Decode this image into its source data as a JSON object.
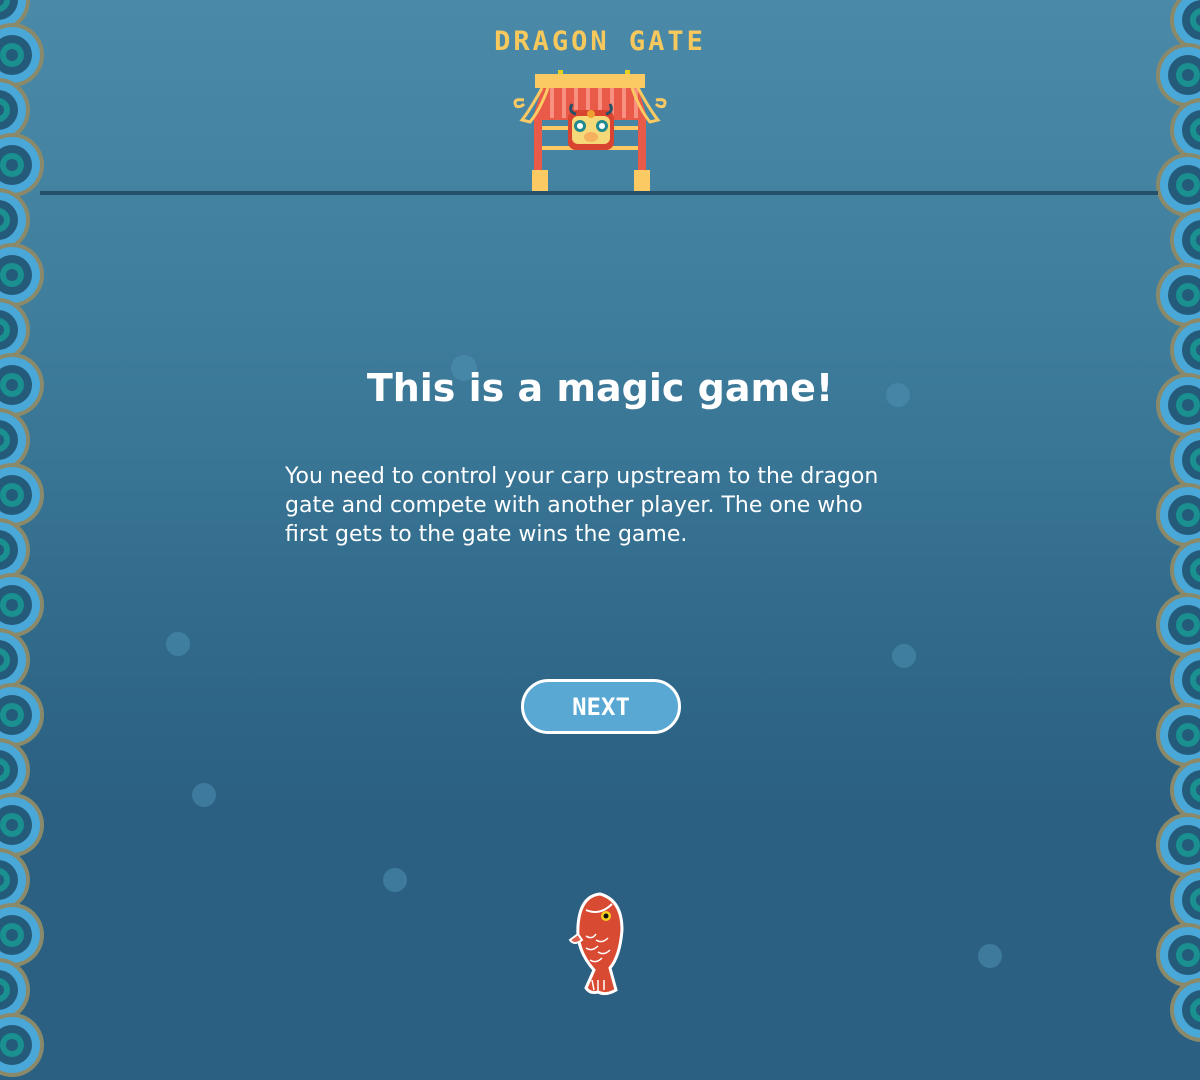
{
  "game": {
    "title": "DRAGON GATE"
  },
  "intro": {
    "heading": "This is a magic game!",
    "body": "You need to control your carp upstream to the dragon gate and compete with another player. The one who first gets to the gate wins the game.",
    "next_label": "NEXT"
  },
  "colors": {
    "title": "#f7c95c",
    "button": "#59a8d4",
    "water_top": "#4a8aa8",
    "water_bottom": "#2b6082",
    "carp": "#d94a32"
  },
  "icons": {
    "gate": "dragon-gate-icon",
    "player": "carp-icon",
    "border": "wave-scale-pattern"
  }
}
